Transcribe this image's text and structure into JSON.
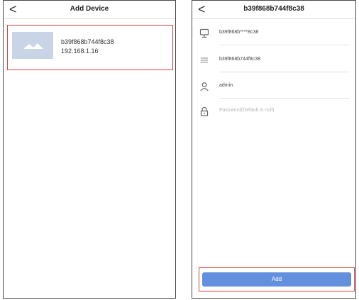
{
  "left_screen": {
    "title": "Add Device",
    "back_symbol": "<",
    "device": {
      "name": "b39f868b744f8c38",
      "ip": "192.168.1.16",
      "thumbnail_icon": "image-placeholder-icon"
    }
  },
  "right_screen": {
    "title": "b39f868b744f8c38",
    "back_symbol": "<",
    "fields": {
      "device_name": {
        "icon": "monitor-icon",
        "value": "b39f868b****8c38"
      },
      "device_id": {
        "icon": "list-icon",
        "value": "b39f868b744f8c38"
      },
      "username": {
        "icon": "user-icon",
        "value": "admin"
      },
      "password": {
        "icon": "lock-icon",
        "placeholder": "Password(Default is null)"
      }
    },
    "add_button_label": "Add"
  },
  "colors": {
    "accent_button": "#6390de",
    "highlight_border": "#d8423a"
  }
}
